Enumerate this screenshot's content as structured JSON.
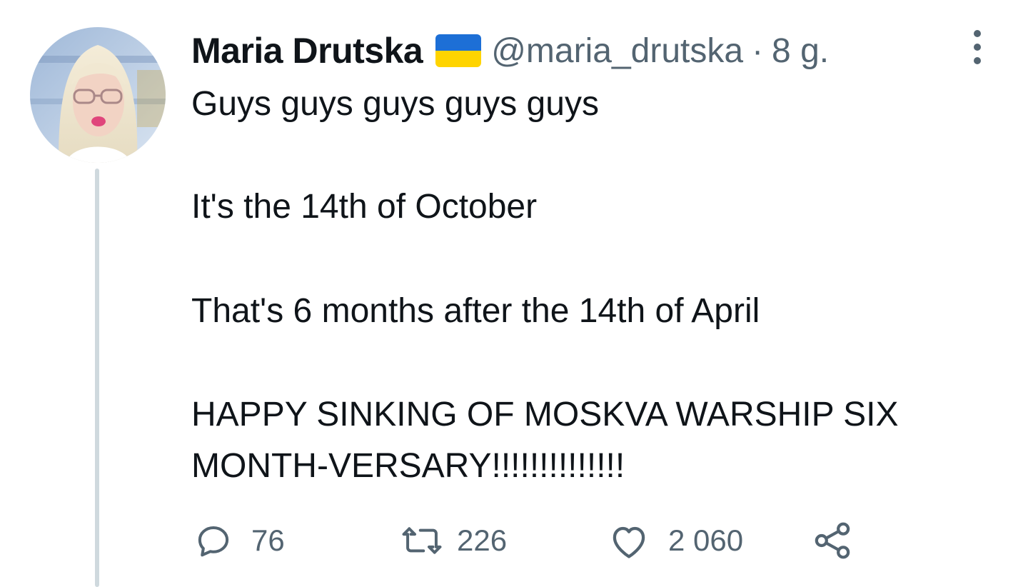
{
  "tweet": {
    "author_name": "Maria Drutska",
    "handle": "@maria_drutska",
    "separator": "·",
    "time": "8 g.",
    "lines": [
      "Guys guys guys guys guys",
      "It's the 14th of October",
      "That's 6 months after the 14th of April",
      "HAPPY SINKING OF MOSKVA WARSHIP SIX",
      "MONTH-VERSARY!!!!!!!!!!!!!!"
    ]
  },
  "flag_colors": {
    "top": "#1d6fd6",
    "bottom": "#ffd400"
  },
  "actions": {
    "reply": {
      "icon": "reply-icon",
      "count": "76"
    },
    "retweet": {
      "icon": "retweet-icon",
      "count": "226"
    },
    "like": {
      "icon": "heart-icon",
      "count": "2 060"
    },
    "share": {
      "icon": "share-icon"
    }
  },
  "colors": {
    "text": "#0f1419",
    "secondary": "#536471",
    "thread_line": "#cfd9de"
  }
}
